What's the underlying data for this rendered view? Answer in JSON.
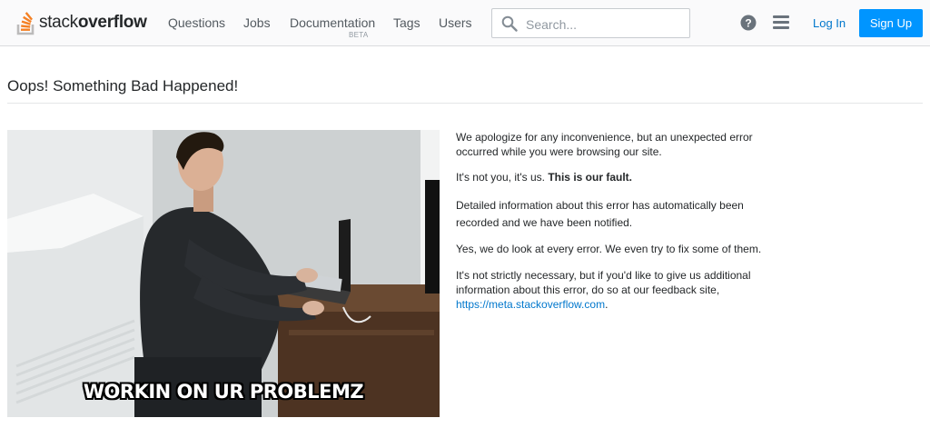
{
  "header": {
    "logo": {
      "text_light": "stack",
      "text_bold": "overflow"
    },
    "nav": [
      {
        "label": "Questions"
      },
      {
        "label": "Jobs"
      },
      {
        "label": "Documentation",
        "sub": "BETA"
      },
      {
        "label": "Tags"
      },
      {
        "label": "Users"
      }
    ],
    "search": {
      "placeholder": "Search..."
    },
    "login_label": "Log In",
    "signup_label": "Sign Up",
    "icons": [
      "search-icon",
      "help-icon",
      "hamburger-menu-icon"
    ]
  },
  "page": {
    "title": "Oops! Something Bad Happened!",
    "image_caption": "WORKIN ON UR PROBLEMZ",
    "paragraphs": [
      {
        "text": "We apologize for any inconvenience, but an unexpected error occurred while you were browsing our site."
      },
      {
        "text": "It's not you, it's us.",
        "bold": "This is our fault."
      },
      {
        "text": "Detailed information about this error has automatically been recorded and we have been notified."
      },
      {
        "text": "Yes, we do look at every error. We even try to fix some of them."
      },
      {
        "text": "It's not strictly necessary, but if you'd like to give us additional information about this error, do so at our feedback site,",
        "link": "https://meta.stackoverflow.com",
        "after": "."
      }
    ]
  },
  "colors": {
    "accent": "#0095ff",
    "link": "#0077cc",
    "logo_orange": "#f48024",
    "logo_gray": "#bcbbbb"
  }
}
